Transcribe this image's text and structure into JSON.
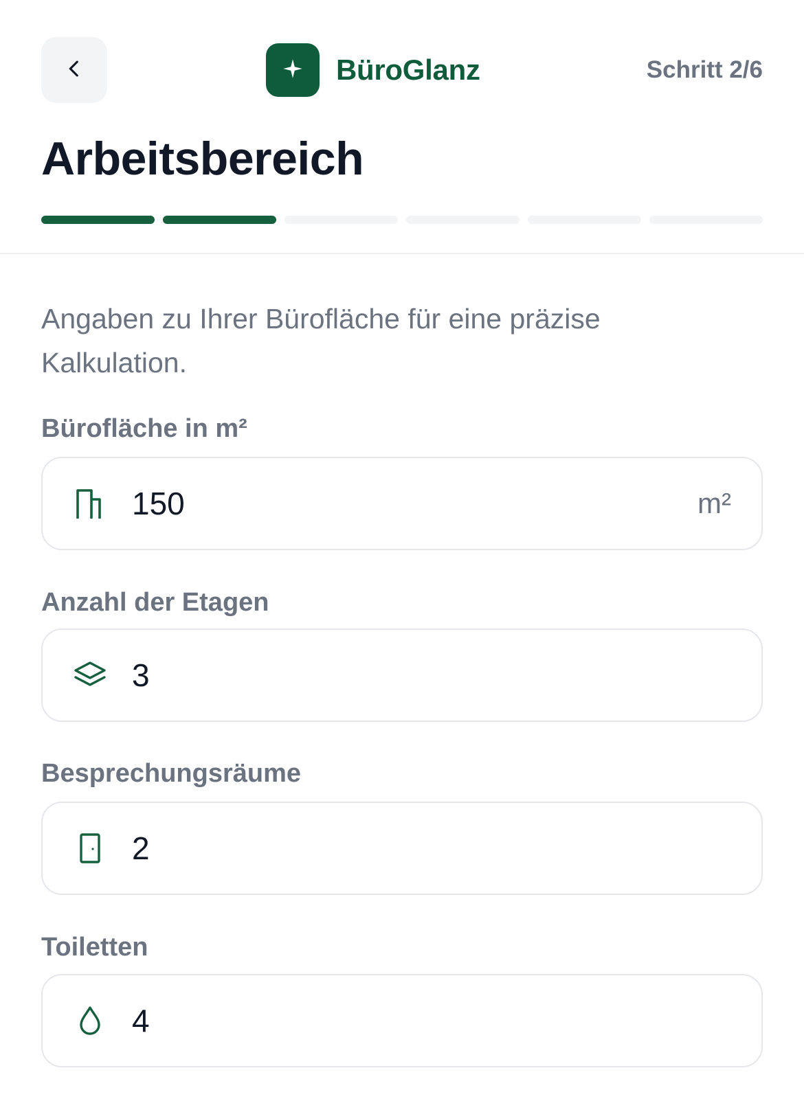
{
  "header": {
    "brand_name": "BüroGlanz",
    "step_text": "Schritt 2/6",
    "back_icon": "chevron-left-icon",
    "logo_icon": "sparkle-icon"
  },
  "page": {
    "title": "Arbeitsbereich",
    "intro": "Angaben zu Ihrer Bürofläche für eine präzise Kalkulation."
  },
  "progress": {
    "current_step": 2,
    "total_steps": 6
  },
  "fields": [
    {
      "label": "Bürofläche in m²",
      "value": "150",
      "unit": "m²",
      "icon": "building-icon"
    },
    {
      "label": "Anzahl der Etagen",
      "value": "3",
      "icon": "layers-icon"
    },
    {
      "label": "Besprechungsräume",
      "value": "2",
      "icon": "door-icon"
    },
    {
      "label": "Toiletten",
      "value": "4",
      "icon": "droplet-icon"
    }
  ],
  "colors": {
    "brand": "#0f5c3c",
    "progress_active": "#17603f",
    "progress_inactive": "#f3f4f6",
    "muted_text": "#6b7280"
  }
}
